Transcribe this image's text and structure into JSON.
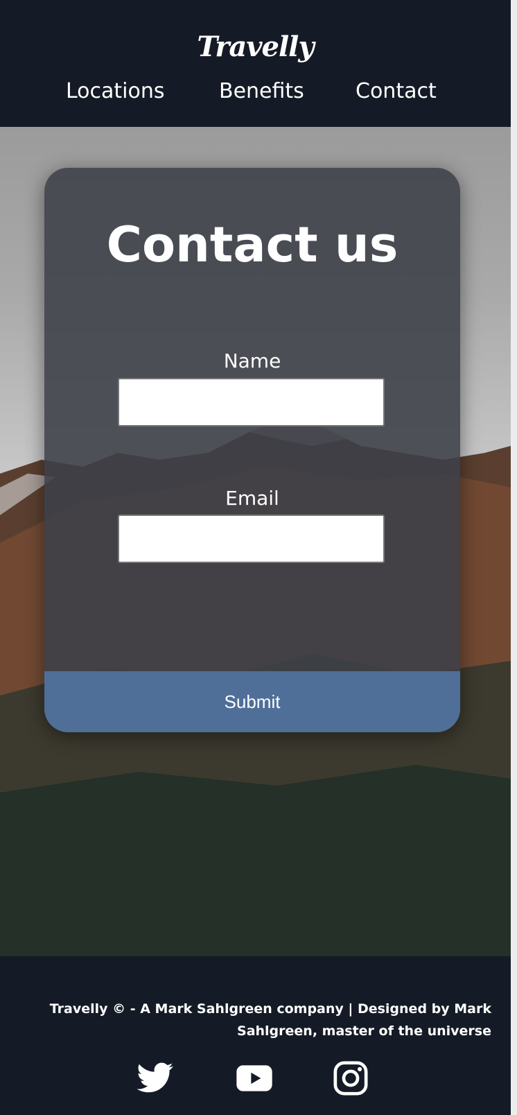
{
  "header": {
    "logo": "Travelly",
    "nav": [
      {
        "label": "Locations"
      },
      {
        "label": "Benefits"
      },
      {
        "label": "Contact"
      }
    ]
  },
  "contact_form": {
    "title": "Contact us",
    "name_label": "Name",
    "name_value": "",
    "email_label": "Email",
    "email_value": "",
    "submit_label": "Submit"
  },
  "footer": {
    "text": "Travelly © - A Mark Sahlgreen company | Designed by Mark Sahlgreen, master of the universe",
    "social": [
      {
        "icon": "twitter-icon"
      },
      {
        "icon": "youtube-icon"
      },
      {
        "icon": "instagram-icon"
      }
    ]
  },
  "colors": {
    "background": "#151b26",
    "card": "#3c4048",
    "submit": "#4f6f99",
    "text": "#ffffff"
  }
}
